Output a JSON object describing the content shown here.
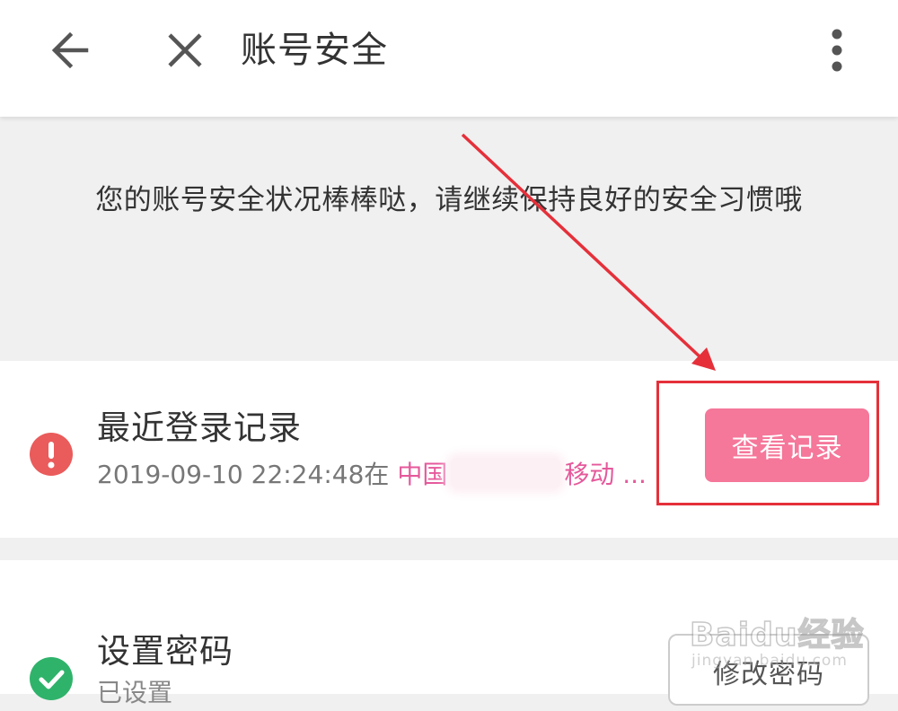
{
  "header": {
    "title": "账号安全",
    "back_icon": "arrow-left-icon",
    "close_icon": "close-icon",
    "more_icon": "more-vertical-icon"
  },
  "status_message": "您的账号安全状况棒棒哒，请继续保持良好的安全习惯哦",
  "login_record": {
    "title": "最近登录记录",
    "detail": {
      "timestamp": "2019-09-10 22:24:48",
      "connector": "在",
      "country": "中国",
      "carrier": "移动 ...",
      "location_redacted": true
    },
    "button_label": "查看记录",
    "status": "warning",
    "status_icon": "exclamation-icon"
  },
  "password": {
    "title": "设置密码",
    "status_text": "已设置",
    "button_label": "修改密码",
    "status": "ok",
    "status_icon": "check-icon"
  },
  "watermark": {
    "logo": "Baidu经验",
    "sub": "jingyan.baidu.com"
  },
  "colors": {
    "accent_pink": "#f5779a",
    "link_pink": "#e5599b",
    "warning_red": "#ea5b5b",
    "success_green": "#2fb36b",
    "annotation_red": "#e5303a",
    "background": "#f0f0f0"
  }
}
